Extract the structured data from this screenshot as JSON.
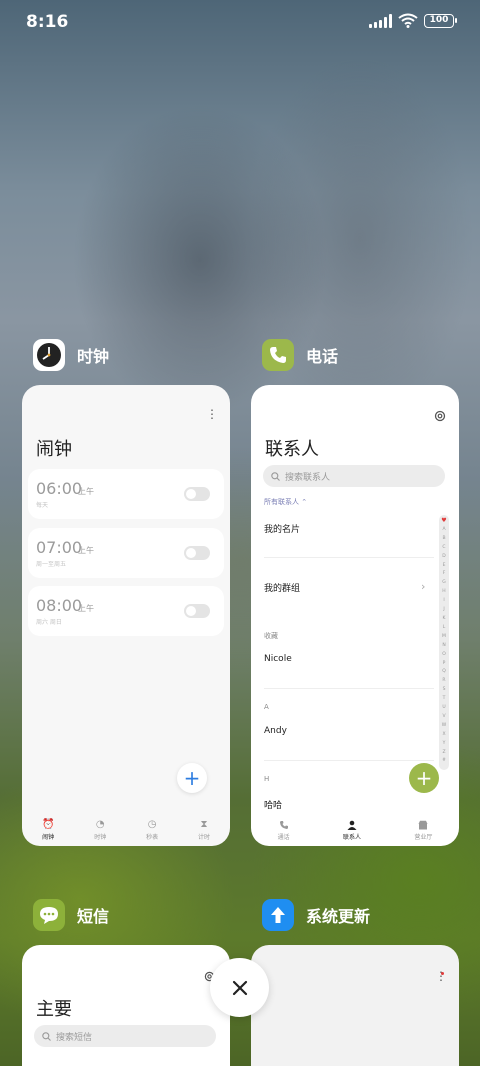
{
  "status_bar": {
    "time": "8:16",
    "battery": "100"
  },
  "apps": {
    "clock": {
      "name": "时钟",
      "title": "闹钟",
      "alarms": [
        {
          "time": "06:00",
          "ampm": "上午",
          "repeat": "每天"
        },
        {
          "time": "07:00",
          "ampm": "上午",
          "repeat": "周一至周五"
        },
        {
          "time": "08:00",
          "ampm": "上午",
          "repeat": "周六 周日"
        }
      ],
      "nav": [
        "闹钟",
        "时钟",
        "秒表",
        "计时"
      ]
    },
    "phone": {
      "name": "电话",
      "title": "联系人",
      "search_placeholder": "搜索联系人",
      "filter_label": "所有联系人 ⌃",
      "my_card": "我的名片",
      "my_groups": "我的群组",
      "favorites_label": "收藏",
      "favorite_contact": "Nicole",
      "section_a": "A",
      "contact_a": "Andy",
      "section_h": "H",
      "contact_h": "哈哈",
      "index_letters": [
        "♥",
        "A",
        "B",
        "C",
        "D",
        "E",
        "F",
        "G",
        "H",
        "I",
        "J",
        "K",
        "L",
        "M",
        "N",
        "O",
        "P",
        "Q",
        "R",
        "S",
        "T",
        "U",
        "V",
        "W",
        "X",
        "Y",
        "Z",
        "#"
      ],
      "nav": [
        "通话",
        "联系人",
        "营业厅"
      ]
    },
    "messages": {
      "name": "短信",
      "title": "主要",
      "search_placeholder": "搜索短信"
    },
    "updater": {
      "name": "系统更新"
    }
  },
  "colors": {
    "phone_accent": "#9cb84b",
    "clock_fab": "#2d7de0",
    "messages_green": "#8db13a",
    "updater_blue": "#1f8ef1"
  }
}
